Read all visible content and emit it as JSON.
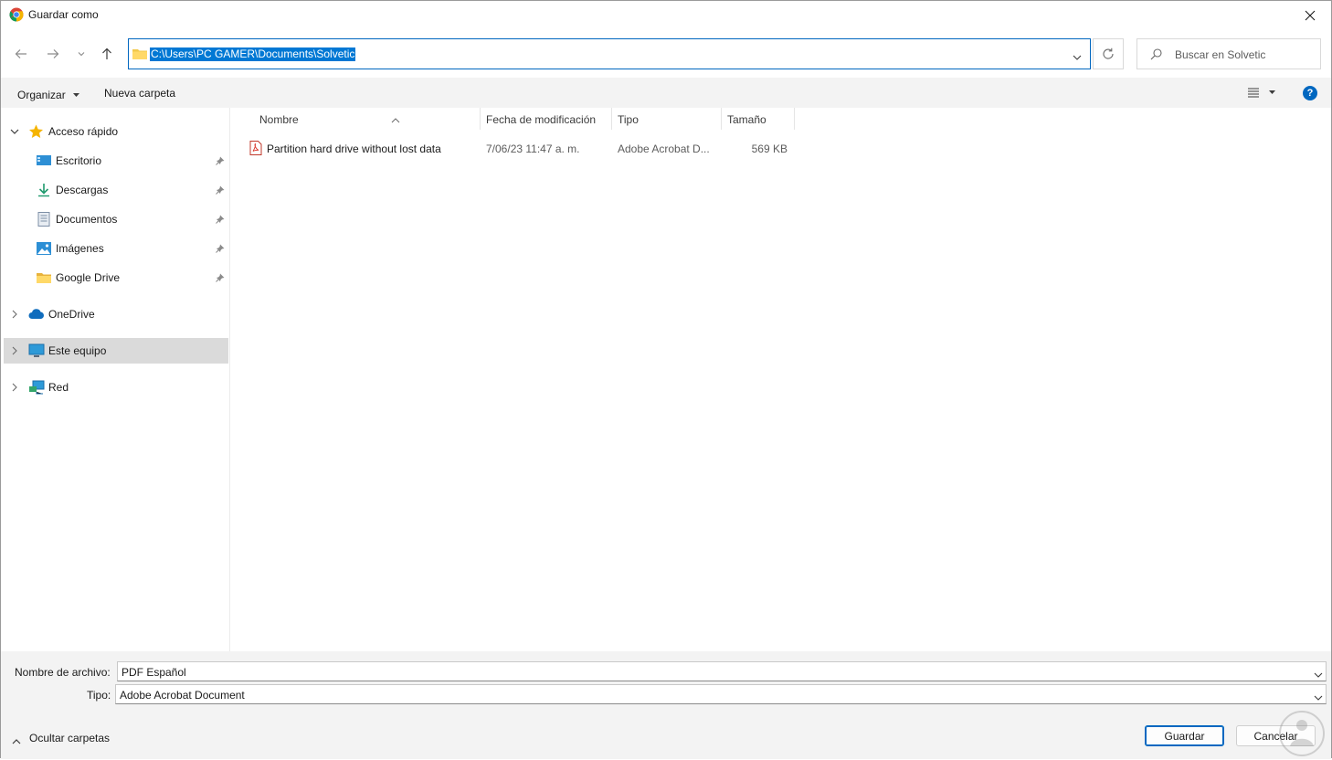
{
  "window": {
    "title": "Guardar como"
  },
  "address_bar": {
    "path": "C:\\Users\\PC GAMER\\Documents\\Solvetic"
  },
  "search": {
    "placeholder": "Buscar en Solvetic"
  },
  "command_bar": {
    "organize_label": "Organizar",
    "new_folder_label": "Nueva carpeta"
  },
  "sidebar": {
    "items": [
      {
        "label": "Acceso rápido",
        "icon": "star-icon",
        "level": 0,
        "expanded": true
      },
      {
        "label": "Escritorio",
        "icon": "desktop-icon",
        "level": 1,
        "pinned": true
      },
      {
        "label": "Descargas",
        "icon": "download-icon",
        "level": 1,
        "pinned": true
      },
      {
        "label": "Documentos",
        "icon": "documents-icon",
        "level": 1,
        "pinned": true
      },
      {
        "label": "Imágenes",
        "icon": "pictures-icon",
        "level": 1,
        "pinned": true
      },
      {
        "label": "Google Drive",
        "icon": "folder-icon",
        "level": 1,
        "pinned": true
      },
      {
        "label": "OneDrive",
        "icon": "cloud-icon",
        "level": 0,
        "expanded": false
      },
      {
        "label": "Este equipo",
        "icon": "computer-icon",
        "level": 0,
        "expanded": false,
        "selected": true
      },
      {
        "label": "Red",
        "icon": "network-icon",
        "level": 0,
        "expanded": false
      }
    ]
  },
  "file_list": {
    "columns": [
      "Nombre",
      "Fecha de modificación",
      "Tipo",
      "Tamaño"
    ],
    "rows": [
      {
        "name": "Partition hard drive without lost data",
        "date": "7/06/23 11:47 a. m.",
        "type": "Adobe Acrobat D...",
        "size": "569 KB",
        "icon": "pdf-icon"
      }
    ]
  },
  "form": {
    "filename_label": "Nombre de archivo:",
    "filename_value": "PDF Español",
    "type_label": "Tipo:",
    "type_value": "Adobe Acrobat Document"
  },
  "footer": {
    "hide_folders_label": "Ocultar carpetas",
    "save_label": "Guardar",
    "cancel_label": "Cancelar"
  },
  "colors": {
    "accent": "#0067c0",
    "selection": "#0078d4",
    "sidebar_selected": "#dadada",
    "command_bar_bg": "#f3f3f3"
  }
}
